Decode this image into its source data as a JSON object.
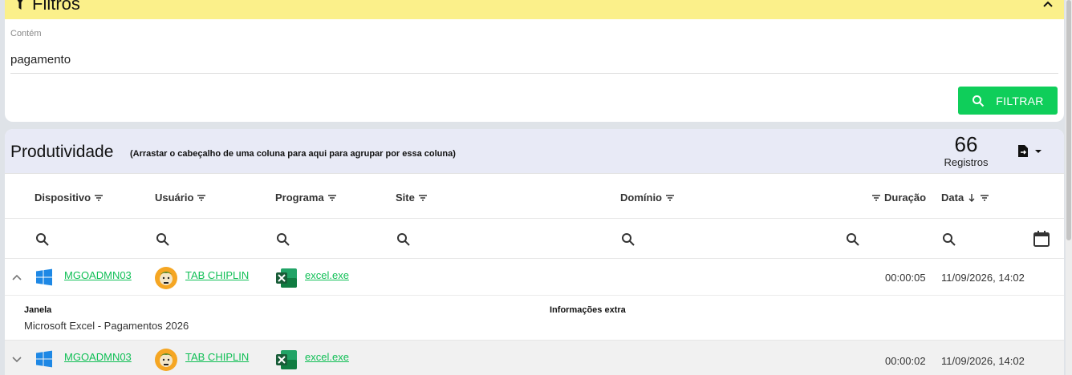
{
  "filters": {
    "title": "Filtros",
    "contains_label": "Contém",
    "contains_value": "pagamento",
    "filter_button": "FILTRAR"
  },
  "productivity": {
    "title": "Produtividade",
    "group_hint": "(Arrastar o cabeçalho de uma coluna para aqui para agrupar por essa coluna)",
    "count": "66",
    "count_label": "Registros"
  },
  "columns": {
    "device": "Dispositivo",
    "user": "Usuário",
    "program": "Programa",
    "site": "Site",
    "domain": "Domínio",
    "duration": "Duração",
    "date": "Data"
  },
  "rows": [
    {
      "device": "MGOADMN03",
      "user": "TAB CHIPLIN",
      "program": "excel.exe",
      "duration": "00:00:05",
      "date": "11/09/2026, 14:02",
      "expanded": true
    },
    {
      "device": "MGOADMN03",
      "user": "TAB CHIPLIN",
      "program": "excel.exe",
      "duration": "00:00:02",
      "date": "11/09/2026, 14:02",
      "expanded": false
    }
  ],
  "detail": {
    "window_label": "Janela",
    "window_value": "Microsoft Excel - Pagamentos 2026",
    "extra_label": "Informações extra"
  },
  "colors": {
    "header_yellow": "#fbf08a",
    "accent_green": "#0fce5a",
    "link_green": "#0fbf55",
    "panel_header": "#e8eaf6"
  },
  "icons": [
    "filter-icon",
    "chevron-up-icon",
    "search-icon",
    "file-export-icon",
    "caret-down-icon",
    "sort-icon",
    "sort-down-arrow-icon",
    "calendar-icon",
    "windows-icon",
    "avatar",
    "excel-icon",
    "chevron-down-icon"
  ]
}
